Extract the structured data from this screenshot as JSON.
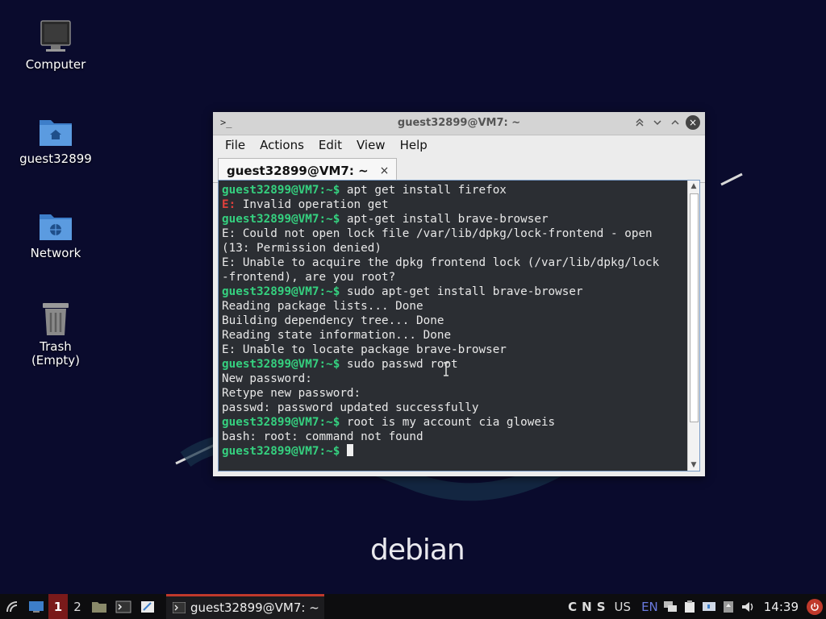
{
  "desktop": {
    "icons": [
      {
        "label": "Computer"
      },
      {
        "label": "guest32899"
      },
      {
        "label": "Network"
      },
      {
        "label": "Trash\n(Empty)"
      }
    ],
    "wallpaper_text": "debian"
  },
  "window": {
    "title": "guest32899@VM7: ~",
    "menu": [
      "File",
      "Actions",
      "Edit",
      "View",
      "Help"
    ],
    "tab_label": "guest32899@VM7: ~",
    "tab_close": "×",
    "controls": {
      "minimize": "^",
      "shade": "v",
      "maximize": "^",
      "close": "×"
    }
  },
  "terminal": {
    "prompt": "guest32899@VM7:~$",
    "lines": [
      {
        "type": "cmd",
        "text": " apt get install firefox"
      },
      {
        "type": "err",
        "prefix": "E:",
        "text": " Invalid operation get"
      },
      {
        "type": "cmd",
        "text": " apt-get install brave-browser"
      },
      {
        "type": "out",
        "text": "E: Could not open lock file /var/lib/dpkg/lock-frontend - open"
      },
      {
        "type": "out",
        "text": "(13: Permission denied)"
      },
      {
        "type": "out",
        "text": "E: Unable to acquire the dpkg frontend lock (/var/lib/dpkg/lock"
      },
      {
        "type": "out",
        "text": "-frontend), are you root?"
      },
      {
        "type": "cmd",
        "text": " sudo apt-get install brave-browser"
      },
      {
        "type": "out",
        "text": "Reading package lists... Done"
      },
      {
        "type": "out",
        "text": "Building dependency tree... Done"
      },
      {
        "type": "out",
        "text": "Reading state information... Done"
      },
      {
        "type": "out",
        "text": "E: Unable to locate package brave-browser"
      },
      {
        "type": "cmd",
        "text": " sudo passwd root"
      },
      {
        "type": "out",
        "text": "New password:"
      },
      {
        "type": "out",
        "text": "Retype new password:"
      },
      {
        "type": "out",
        "text": "passwd: password updated successfully"
      },
      {
        "type": "cmd",
        "text": " root is my account cia gloweis"
      },
      {
        "type": "out",
        "text": "bash: root: command not found"
      },
      {
        "type": "cursor",
        "text": " "
      }
    ]
  },
  "taskbar": {
    "workspaces": [
      "1",
      "2"
    ],
    "active_task": "guest32899@VM7: ~",
    "tray_letters": [
      "C",
      "N",
      "S"
    ],
    "layout": "US",
    "lang": "EN",
    "time": "14:39"
  }
}
